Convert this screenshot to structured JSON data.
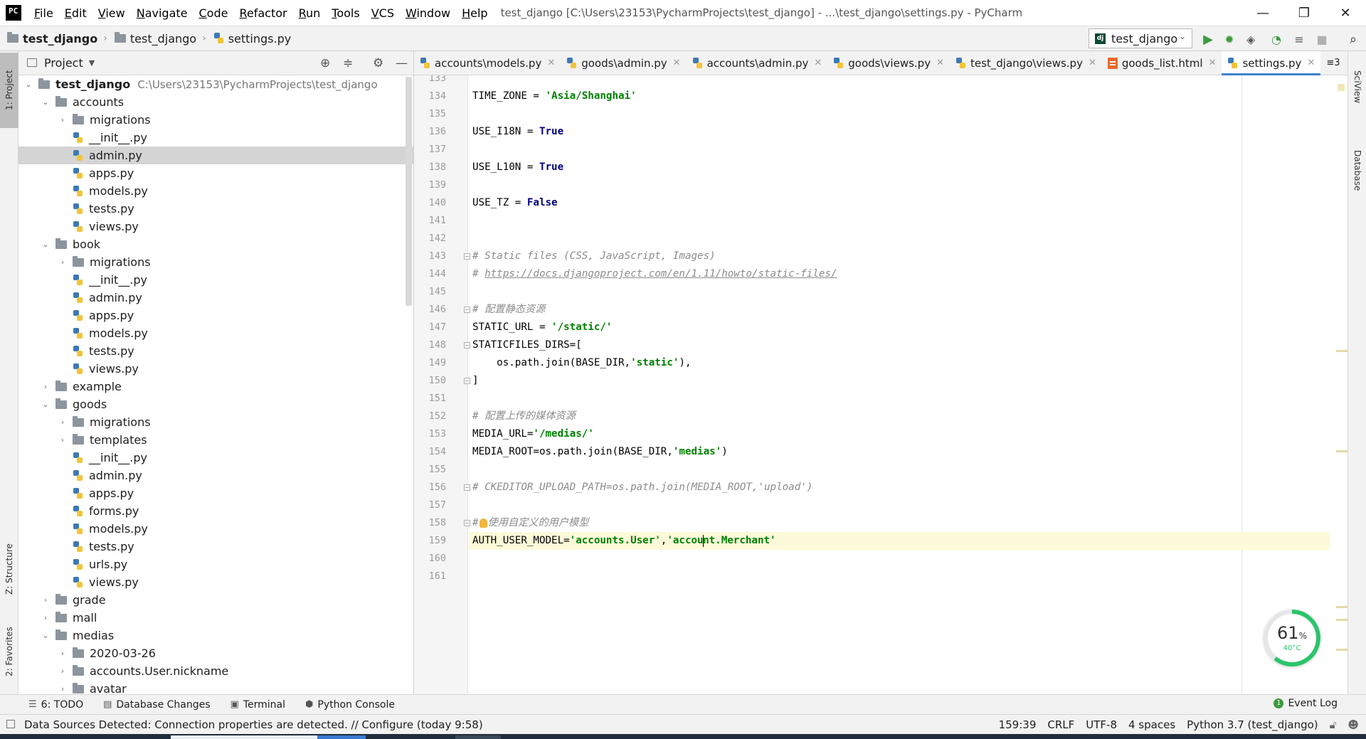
{
  "window": {
    "title": "test_django [C:\\Users\\23153\\PycharmProjects\\test_django] - ...\\test_django\\settings.py - PyCharm",
    "menu": [
      "File",
      "Edit",
      "View",
      "Navigate",
      "Code",
      "Refactor",
      "Run",
      "Tools",
      "VCS",
      "Window",
      "Help"
    ],
    "controls": {
      "minimize": "—",
      "restore": "❐",
      "close": "✕"
    }
  },
  "breadcrumb": [
    "test_django",
    "test_django",
    "settings.py"
  ],
  "run_config": "test_django",
  "left_stripe": {
    "project": "1: Project",
    "structure": "Z: Structure",
    "favorites": "2: Favorites"
  },
  "right_stripe": {
    "sciview": "SciView",
    "database": "Database"
  },
  "project_panel": {
    "title": "Project",
    "root_name": "test_django",
    "root_path": "C:\\Users\\23153\\PycharmProjects\\test_django",
    "tree": [
      {
        "label": "accounts",
        "depth": 1,
        "type": "folder",
        "state": "open"
      },
      {
        "label": "migrations",
        "depth": 2,
        "type": "folder",
        "state": "closed"
      },
      {
        "label": "__init__.py",
        "depth": 2,
        "type": "py",
        "state": "none"
      },
      {
        "label": "admin.py",
        "depth": 2,
        "type": "py",
        "state": "none",
        "selected": true
      },
      {
        "label": "apps.py",
        "depth": 2,
        "type": "py",
        "state": "none"
      },
      {
        "label": "models.py",
        "depth": 2,
        "type": "py",
        "state": "none"
      },
      {
        "label": "tests.py",
        "depth": 2,
        "type": "py",
        "state": "none"
      },
      {
        "label": "views.py",
        "depth": 2,
        "type": "py",
        "state": "none"
      },
      {
        "label": "book",
        "depth": 1,
        "type": "folder",
        "state": "open"
      },
      {
        "label": "migrations",
        "depth": 2,
        "type": "folder",
        "state": "closed"
      },
      {
        "label": "__init__.py",
        "depth": 2,
        "type": "py",
        "state": "none"
      },
      {
        "label": "admin.py",
        "depth": 2,
        "type": "py",
        "state": "none"
      },
      {
        "label": "apps.py",
        "depth": 2,
        "type": "py",
        "state": "none"
      },
      {
        "label": "models.py",
        "depth": 2,
        "type": "py",
        "state": "none"
      },
      {
        "label": "tests.py",
        "depth": 2,
        "type": "py",
        "state": "none"
      },
      {
        "label": "views.py",
        "depth": 2,
        "type": "py",
        "state": "none"
      },
      {
        "label": "example",
        "depth": 1,
        "type": "folder",
        "state": "closed"
      },
      {
        "label": "goods",
        "depth": 1,
        "type": "folder",
        "state": "open"
      },
      {
        "label": "migrations",
        "depth": 2,
        "type": "folder",
        "state": "closed"
      },
      {
        "label": "templates",
        "depth": 2,
        "type": "folder",
        "state": "closed"
      },
      {
        "label": "__init__.py",
        "depth": 2,
        "type": "py",
        "state": "none"
      },
      {
        "label": "admin.py",
        "depth": 2,
        "type": "py",
        "state": "none"
      },
      {
        "label": "apps.py",
        "depth": 2,
        "type": "py",
        "state": "none"
      },
      {
        "label": "forms.py",
        "depth": 2,
        "type": "py",
        "state": "none"
      },
      {
        "label": "models.py",
        "depth": 2,
        "type": "py",
        "state": "none"
      },
      {
        "label": "tests.py",
        "depth": 2,
        "type": "py",
        "state": "none"
      },
      {
        "label": "urls.py",
        "depth": 2,
        "type": "py",
        "state": "none"
      },
      {
        "label": "views.py",
        "depth": 2,
        "type": "py",
        "state": "none"
      },
      {
        "label": "grade",
        "depth": 1,
        "type": "folder",
        "state": "closed"
      },
      {
        "label": "mall",
        "depth": 1,
        "type": "folder",
        "state": "closed"
      },
      {
        "label": "medias",
        "depth": 1,
        "type": "folder",
        "state": "open"
      },
      {
        "label": "2020-03-26",
        "depth": 2,
        "type": "folder",
        "state": "closed"
      },
      {
        "label": "accounts.User.nickname",
        "depth": 2,
        "type": "folder",
        "state": "closed"
      },
      {
        "label": "avatar",
        "depth": 2,
        "type": "folder",
        "state": "closed"
      }
    ]
  },
  "editor_tabs": [
    {
      "label": "accounts\\models.py",
      "type": "py"
    },
    {
      "label": "goods\\admin.py",
      "type": "py"
    },
    {
      "label": "accounts\\admin.py",
      "type": "py"
    },
    {
      "label": "goods\\views.py",
      "type": "py"
    },
    {
      "label": "test_django\\views.py",
      "type": "py"
    },
    {
      "label": "goods_list.html",
      "type": "html"
    },
    {
      "label": "settings.py",
      "type": "py",
      "active": true
    }
  ],
  "tab_overflow": "≡3",
  "code": [
    {
      "n": "133",
      "tokens": []
    },
    {
      "n": "134",
      "tokens": [
        [
          "",
          "TIME_ZONE = "
        ],
        [
          "str",
          "'Asia/Shanghai'"
        ]
      ]
    },
    {
      "n": "135",
      "tokens": []
    },
    {
      "n": "136",
      "tokens": [
        [
          "",
          "USE_I18N = "
        ],
        [
          "kw",
          "True"
        ]
      ]
    },
    {
      "n": "137",
      "tokens": []
    },
    {
      "n": "138",
      "tokens": [
        [
          "",
          "USE_L10N = "
        ],
        [
          "kw",
          "True"
        ]
      ]
    },
    {
      "n": "139",
      "tokens": []
    },
    {
      "n": "140",
      "tokens": [
        [
          "",
          "USE_TZ = "
        ],
        [
          "kw",
          "False"
        ]
      ]
    },
    {
      "n": "141",
      "tokens": []
    },
    {
      "n": "142",
      "tokens": []
    },
    {
      "n": "143",
      "tokens": [
        [
          "cmt",
          "# Static files (CSS, JavaScript, Images)"
        ]
      ],
      "fold": true
    },
    {
      "n": "144",
      "tokens": [
        [
          "cmt",
          "# "
        ],
        [
          "link",
          "https://docs.djangoproject.com/en/1.11/howto/static-files/"
        ]
      ]
    },
    {
      "n": "145",
      "tokens": []
    },
    {
      "n": "146",
      "tokens": [
        [
          "cmt",
          "# 配置静态资源"
        ]
      ],
      "fold": true
    },
    {
      "n": "147",
      "tokens": [
        [
          "",
          "STATIC_URL = "
        ],
        [
          "str",
          "'/static/'"
        ]
      ]
    },
    {
      "n": "148",
      "tokens": [
        [
          "",
          "STATICFILES_DIRS=["
        ]
      ],
      "fold": true
    },
    {
      "n": "149",
      "tokens": [
        [
          "",
          "    os.path.join(BASE_DIR,"
        ],
        [
          "str",
          "'static'"
        ],
        [
          "",
          "),"
        ]
      ]
    },
    {
      "n": "150",
      "tokens": [
        [
          "",
          "]"
        ]
      ],
      "fold": true
    },
    {
      "n": "151",
      "tokens": []
    },
    {
      "n": "152",
      "tokens": [
        [
          "cmt",
          "# 配置上传的媒体资源"
        ]
      ]
    },
    {
      "n": "153",
      "tokens": [
        [
          "",
          "MEDIA_URL="
        ],
        [
          "str",
          "'/medias/'"
        ]
      ]
    },
    {
      "n": "154",
      "tokens": [
        [
          "",
          "MEDIA_ROOT=os.path.join(BASE_DIR,"
        ],
        [
          "str",
          "'medias'"
        ],
        [
          "",
          ")"
        ]
      ]
    },
    {
      "n": "155",
      "tokens": []
    },
    {
      "n": "156",
      "tokens": [
        [
          "cmt",
          "# CKEDITOR_UPLOAD_PATH=os.path.join(MEDIA_ROOT,'upload')"
        ]
      ],
      "fold": true
    },
    {
      "n": "157",
      "tokens": []
    },
    {
      "n": "158",
      "tokens": [
        [
          "cmt",
          "#"
        ],
        [
          "bulb",
          ""
        ],
        [
          "cmt",
          "使用自定义的用户模型"
        ]
      ],
      "fold": true
    },
    {
      "n": "159",
      "tokens": [
        [
          "",
          "AUTH_USER_MODEL="
        ],
        [
          "str",
          "'accounts.User'"
        ],
        [
          "",
          ","
        ],
        [
          "str",
          "'accou"
        ],
        [
          "caret",
          ""
        ],
        [
          "str",
          "nt.Merchant'"
        ]
      ],
      "current": true
    },
    {
      "n": "160",
      "tokens": []
    },
    {
      "n": "161",
      "tokens": []
    }
  ],
  "gauge": {
    "percent": 61,
    "pct_label": "61",
    "pct_unit": "%",
    "temp": "40°C"
  },
  "bottom_tools": [
    "6: TODO",
    "Database Changes",
    "Terminal",
    "Python Console"
  ],
  "event_log": {
    "badge": "1",
    "label": "Event Log"
  },
  "status": {
    "message": "Data Sources Detected: Connection properties are detected. // Configure (today 9:58)",
    "position": "159:39",
    "line_sep": "CRLF",
    "encoding": "UTF-8",
    "indent": "4 spaces",
    "interpreter": "Python 3.7 (test_django)"
  },
  "colors": {
    "accent": "#4083c9",
    "selection": "#d4d4d4",
    "current_line": "#fcfad9",
    "string": "#008000",
    "keyword": "#000080",
    "comment": "#8c8c8c"
  }
}
